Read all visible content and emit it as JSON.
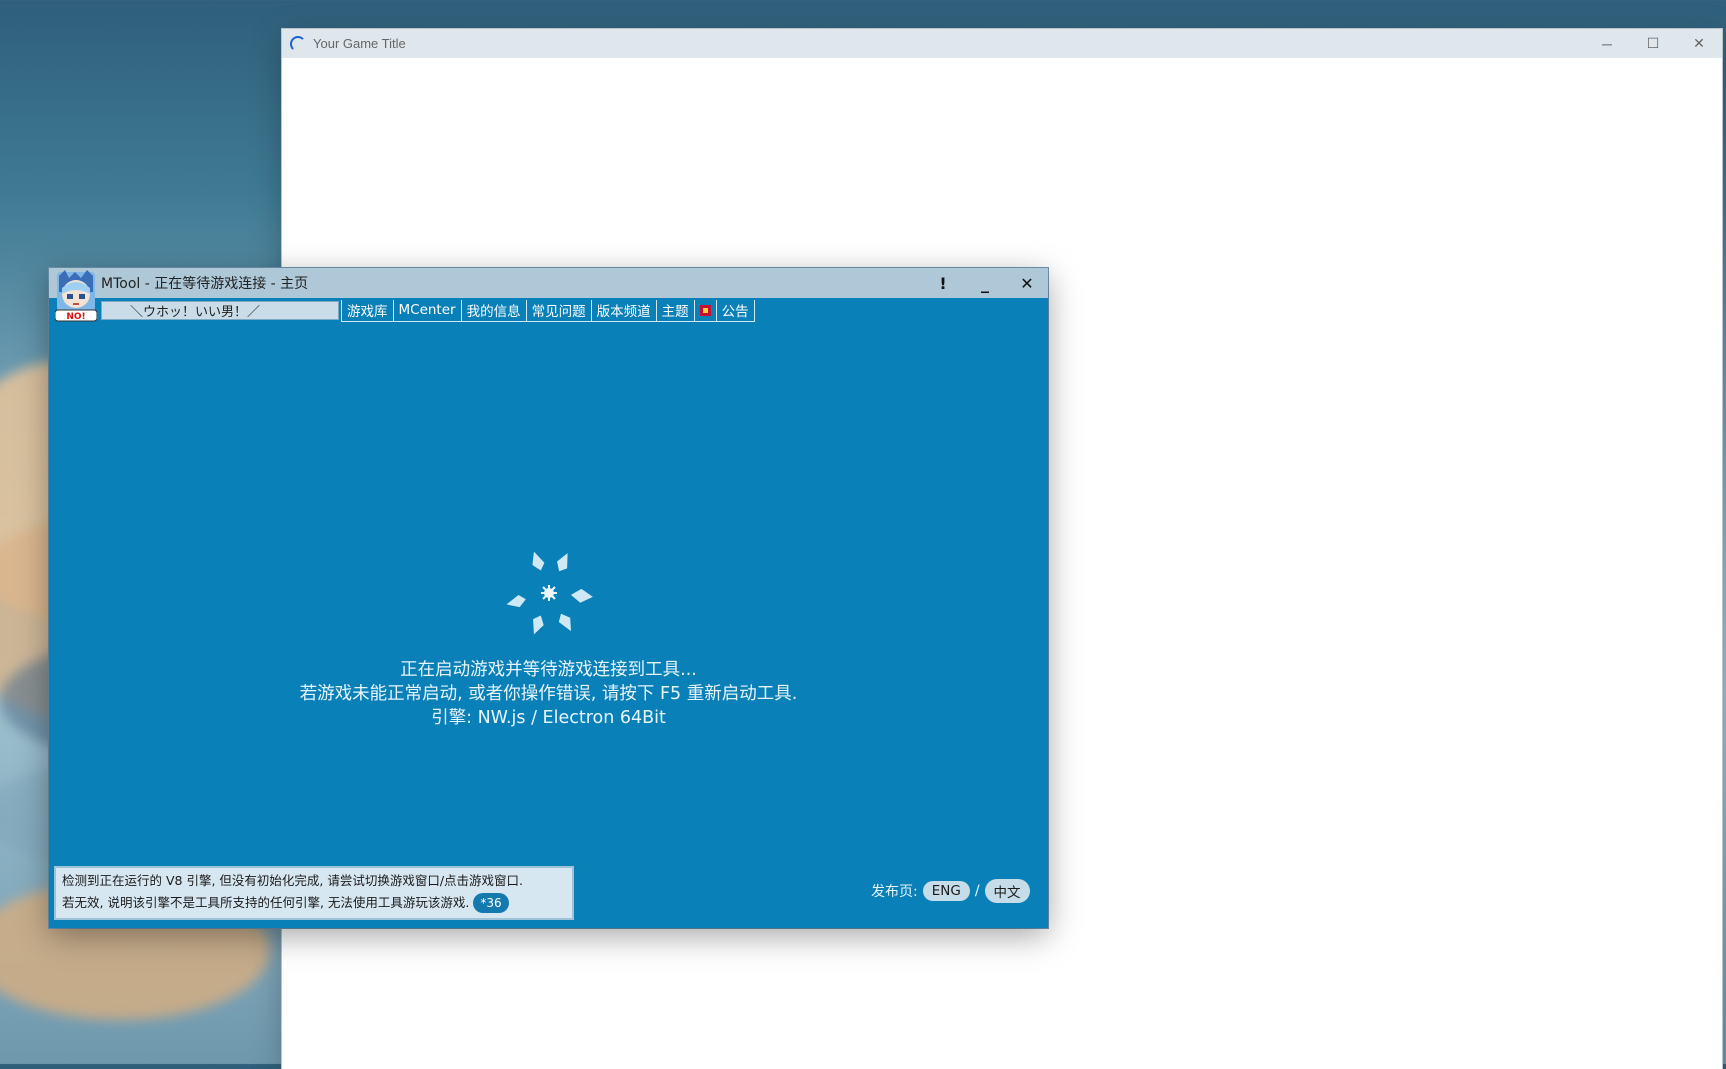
{
  "game_window": {
    "title": "Your Game Title",
    "controls": {
      "minimize": "─",
      "maximize": "☐",
      "close": "✕"
    }
  },
  "mtool": {
    "title": "MTool - 正在等待游戏连接 - 主页",
    "controls": {
      "alert": "!",
      "minimize": "_",
      "close": "✕"
    },
    "motto": "＼ウホッ！いい男！／",
    "tabs": [
      "游戏库",
      "MCenter",
      "我的信息",
      "常见问题",
      "版本频道",
      "主题"
    ],
    "tab_last": "公告",
    "message": {
      "line1": "正在启动游戏并等待游戏连接到工具...",
      "line2": "若游戏未能正常启动, 或者你操作错误, 请按下 F5 重新启动工具.",
      "line3": "引擎: NW.js / Electron 64Bit"
    },
    "notice": {
      "line1": "检测到正在运行的 V8 引擎, 但没有初始化完成, 请尝试切换游戏窗口/点击游戏窗口.",
      "line2": "若无效, 说明该引擎不是工具所支持的任何引擎, 无法使用工具游玩该游戏.",
      "badge": "*36"
    },
    "release": {
      "label": "发布页:",
      "eng": "ENG",
      "separator": "/",
      "cn": "中文"
    },
    "avatar_badge": "NO!"
  }
}
